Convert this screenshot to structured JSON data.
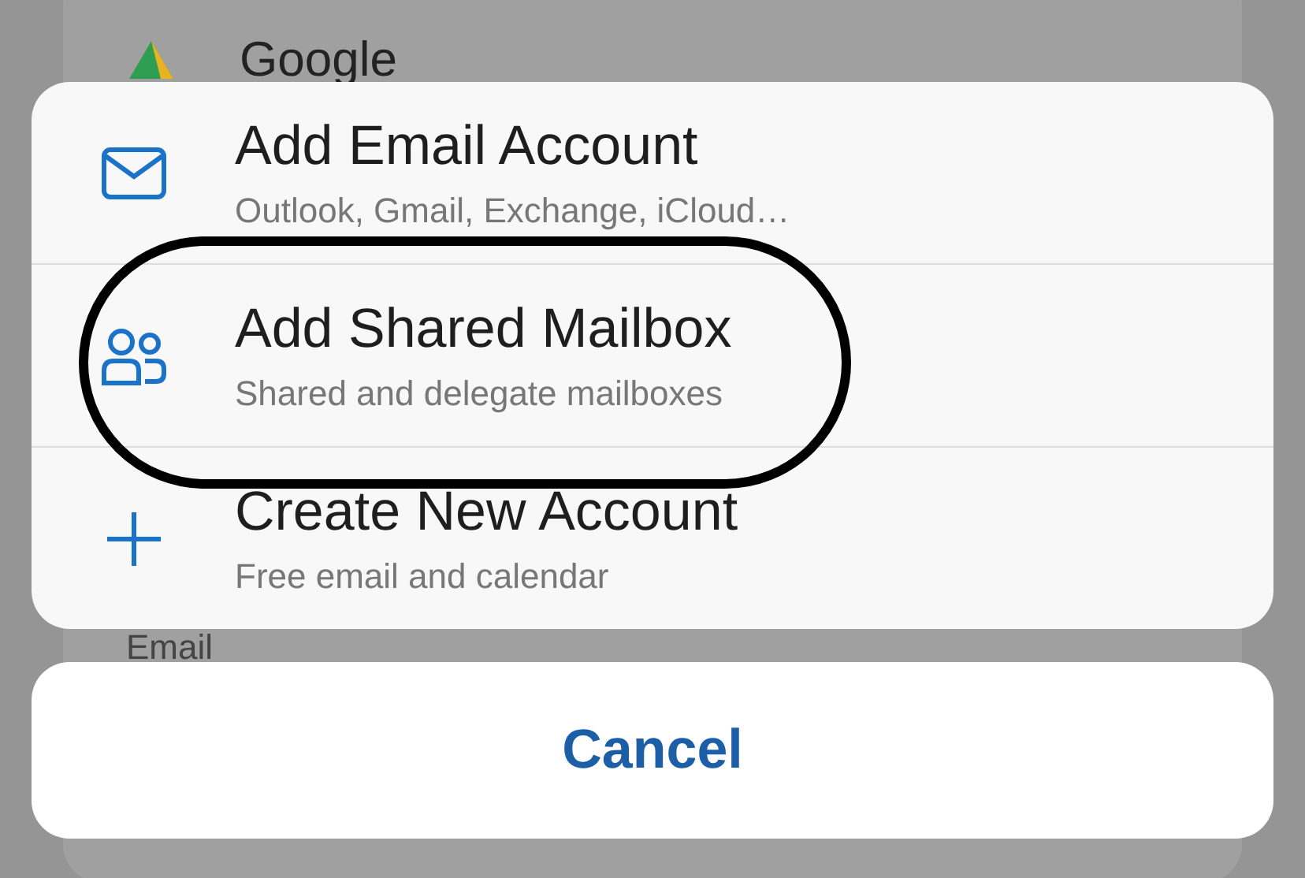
{
  "background_list": {
    "rows": [
      {
        "kind": "account",
        "label": "Google"
      },
      {
        "kind": "section",
        "label": "Email"
      }
    ]
  },
  "action_sheet": {
    "options": [
      {
        "kind": "mail",
        "title": "Add Email Account",
        "subtitle": "Outlook, Gmail, Exchange, iCloud…",
        "circled": false
      },
      {
        "kind": "people",
        "title": "Add Shared Mailbox",
        "subtitle": "Shared and delegate mailboxes",
        "circled": true
      },
      {
        "kind": "plus",
        "title": "Create New Account",
        "subtitle": "Free email and calendar",
        "circled": false
      }
    ]
  },
  "cancel_button": {
    "label": "Cancel"
  }
}
